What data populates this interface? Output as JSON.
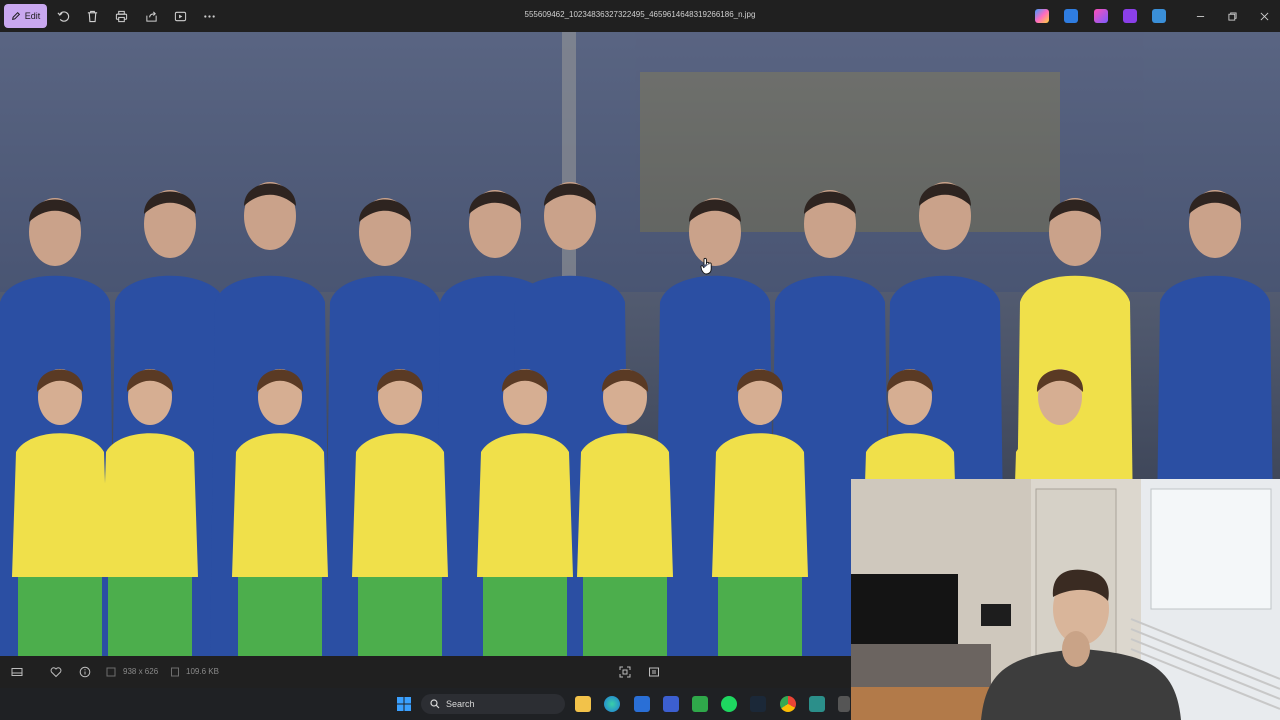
{
  "toolbar": {
    "edit_label": "Edit",
    "file_name": "555609462_10234836327322495_4659614648319266186_n.jpg",
    "icons": [
      "edit-icon",
      "rotate-icon",
      "delete-icon",
      "print-icon",
      "share-icon",
      "slideshow-icon",
      "more-icon"
    ],
    "app_icons": [
      "copilot-icon",
      "app-icon-2",
      "app-icon-3",
      "app-icon-4",
      "app-icon-5"
    ],
    "window_controls": [
      "minimize",
      "restore",
      "close"
    ]
  },
  "status": {
    "dimensions": "938 x 626",
    "file_size": "109.6 KB",
    "icons": [
      "filmstrip-icon",
      "favorite-icon",
      "info-icon",
      "dimensions-icon",
      "filesize-icon",
      "zoom-fit-icon",
      "actual-size-icon"
    ]
  },
  "taskbar": {
    "search_label": "Search",
    "apps": [
      "windows-start",
      "search",
      "widgets",
      "file-explorer",
      "edge",
      "store",
      "app-x",
      "xbox",
      "spotify",
      "steam",
      "chrome",
      "app-s",
      "overflow"
    ]
  },
  "colors": {
    "accent": "#c9a8f0",
    "toolbar_bg": "#202020",
    "jersey_blue": "#2b4fa3",
    "kit_yellow": "#f0e04a",
    "kit_green": "#4cae4c"
  }
}
